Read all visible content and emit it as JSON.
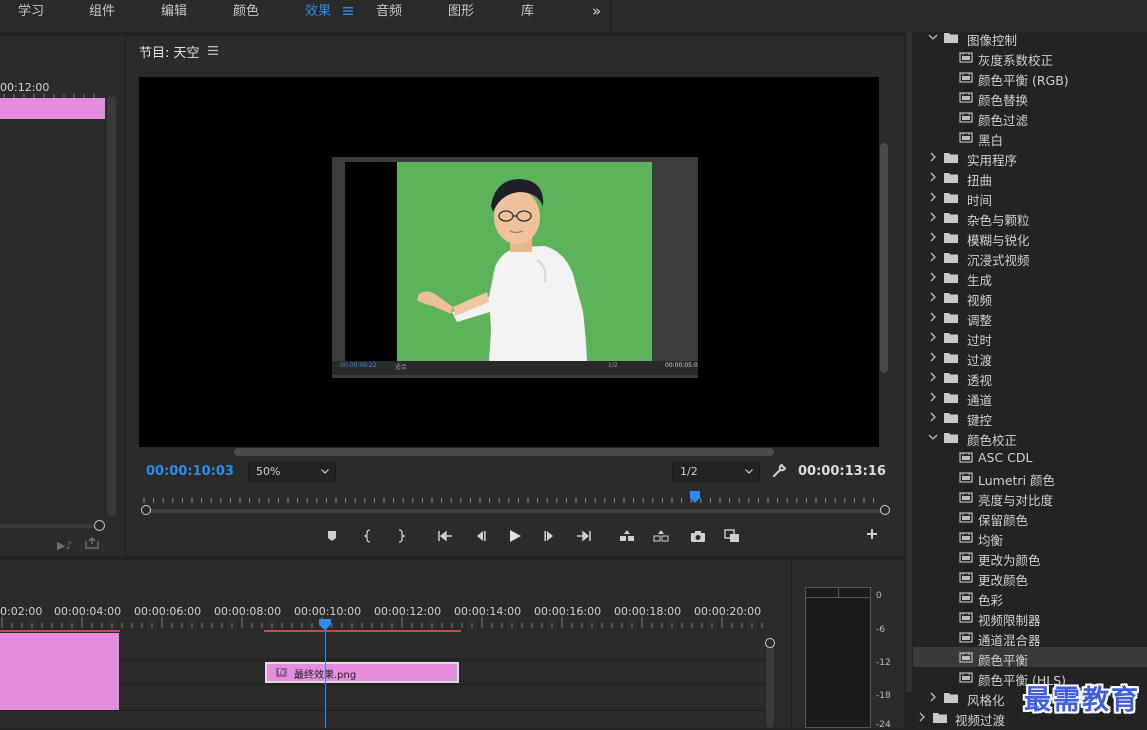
{
  "workspace_tabs": [
    {
      "label": "学习",
      "active": false
    },
    {
      "label": "组件",
      "active": false
    },
    {
      "label": "编辑",
      "active": false
    },
    {
      "label": "颜色",
      "active": false
    },
    {
      "label": "效果",
      "active": true
    },
    {
      "label": "音频",
      "active": false
    },
    {
      "label": "图形",
      "active": false
    },
    {
      "label": "库",
      "active": false
    }
  ],
  "workspace_more": "»",
  "source_panel": {
    "ruler_time": "00:12:00"
  },
  "program_monitor": {
    "title": "节目: 天空",
    "current_timecode": "00:00:10:03",
    "zoom": "50%",
    "resolution": "1/2",
    "duration_timecode": "00:00:13:16",
    "nested_preview": {
      "timecode": "00:00:00:22",
      "fit": "适合",
      "resolution": "1/2",
      "duration": "00:00:05:0"
    }
  },
  "effects_tree": [
    {
      "label": "图像控制",
      "type": "folder",
      "expanded": true,
      "level": 1
    },
    {
      "label": "灰度系数校正",
      "type": "effect",
      "level": 2
    },
    {
      "label": "颜色平衡 (RGB)",
      "type": "effect",
      "level": 2
    },
    {
      "label": "颜色替换",
      "type": "effect",
      "level": 2
    },
    {
      "label": "颜色过滤",
      "type": "effect",
      "level": 2
    },
    {
      "label": "黑白",
      "type": "effect",
      "level": 2
    },
    {
      "label": "实用程序",
      "type": "folder",
      "expanded": false,
      "level": 1
    },
    {
      "label": "扭曲",
      "type": "folder",
      "expanded": false,
      "level": 1
    },
    {
      "label": "时间",
      "type": "folder",
      "expanded": false,
      "level": 1
    },
    {
      "label": "杂色与颗粒",
      "type": "folder",
      "expanded": false,
      "level": 1
    },
    {
      "label": "模糊与锐化",
      "type": "folder",
      "expanded": false,
      "level": 1
    },
    {
      "label": "沉浸式视频",
      "type": "folder",
      "expanded": false,
      "level": 1
    },
    {
      "label": "生成",
      "type": "folder",
      "expanded": false,
      "level": 1
    },
    {
      "label": "视频",
      "type": "folder",
      "expanded": false,
      "level": 1
    },
    {
      "label": "调整",
      "type": "folder",
      "expanded": false,
      "level": 1
    },
    {
      "label": "过时",
      "type": "folder",
      "expanded": false,
      "level": 1
    },
    {
      "label": "过渡",
      "type": "folder",
      "expanded": false,
      "level": 1
    },
    {
      "label": "透视",
      "type": "folder",
      "expanded": false,
      "level": 1
    },
    {
      "label": "通道",
      "type": "folder",
      "expanded": false,
      "level": 1
    },
    {
      "label": "键控",
      "type": "folder",
      "expanded": false,
      "level": 1
    },
    {
      "label": "颜色校正",
      "type": "folder",
      "expanded": true,
      "level": 1
    },
    {
      "label": "ASC CDL",
      "type": "effect",
      "level": 2
    },
    {
      "label": "Lumetri 颜色",
      "type": "effect",
      "level": 2
    },
    {
      "label": "亮度与对比度",
      "type": "effect",
      "level": 2
    },
    {
      "label": "保留颜色",
      "type": "effect",
      "level": 2
    },
    {
      "label": "均衡",
      "type": "effect",
      "level": 2
    },
    {
      "label": "更改为颜色",
      "type": "effect",
      "level": 2
    },
    {
      "label": "更改颜色",
      "type": "effect",
      "level": 2
    },
    {
      "label": "色彩",
      "type": "effect",
      "level": 2
    },
    {
      "label": "视频限制器",
      "type": "effect",
      "level": 2
    },
    {
      "label": "通道混合器",
      "type": "effect",
      "level": 2
    },
    {
      "label": "颜色平衡",
      "type": "effect",
      "level": 2,
      "selected": true
    },
    {
      "label": "颜色平衡 (HLS)",
      "type": "effect",
      "level": 2
    },
    {
      "label": "风格化",
      "type": "folder",
      "expanded": false,
      "level": 1
    },
    {
      "label": "视频过渡",
      "type": "folder",
      "expanded": false,
      "level": 0
    }
  ],
  "timeline": {
    "ruler_labels": [
      "0:02:00",
      "00:00:04:00",
      "00:00:06:00",
      "00:00:08:00",
      "00:00:10:00",
      "00:00:12:00",
      "00:00:14:00",
      "00:00:16:00",
      "00:00:18:00",
      "00:00:20:00"
    ],
    "clip_name": "最终效果.png",
    "clip_badge": "fx"
  },
  "audio_meter": {
    "ticks": [
      "0",
      "-6",
      "-12",
      "-18",
      "-24"
    ]
  },
  "watermark": "最需教育",
  "colors": {
    "accent": "#2d8ceb",
    "clip_pink": "#e48cde",
    "green_screen": "#5db35a",
    "workarea_red": "#d04545"
  }
}
